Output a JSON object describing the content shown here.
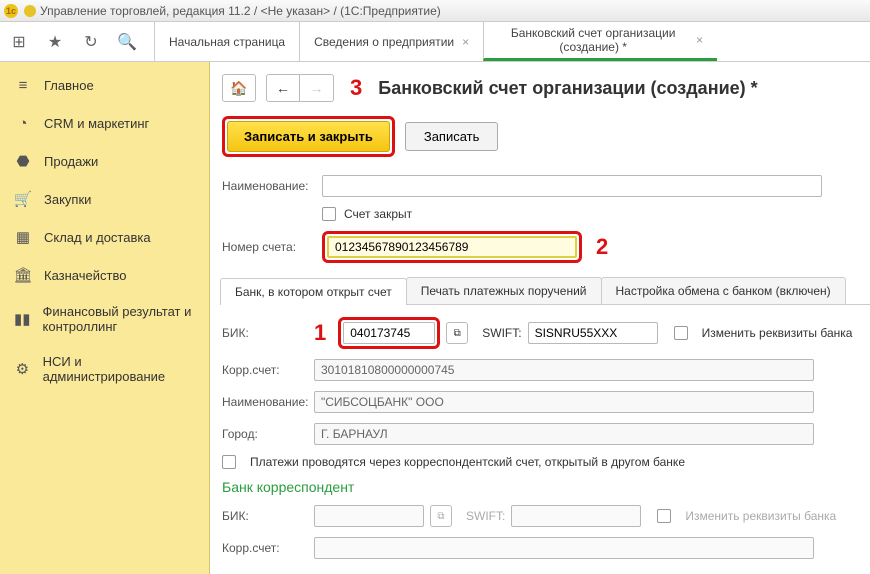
{
  "window": {
    "title": "Управление торговлей, редакция 11.2 / <Не указан> / (1С:Предприятие)"
  },
  "topTabs": [
    {
      "label": "Начальная страница"
    },
    {
      "label": "Сведения о предприятии"
    },
    {
      "label": "Банковский счет организации (создание) *",
      "active": true
    }
  ],
  "sidebar": {
    "items": [
      {
        "icon": "menu",
        "label": "Главное"
      },
      {
        "icon": "pie",
        "label": "CRM и маркетинг"
      },
      {
        "icon": "tag",
        "label": "Продажи"
      },
      {
        "icon": "cart",
        "label": "Закупки"
      },
      {
        "icon": "grid",
        "label": "Склад и доставка"
      },
      {
        "icon": "bank",
        "label": "Казначейство"
      },
      {
        "icon": "bars",
        "label": "Финансовый результат и контроллинг"
      },
      {
        "icon": "gear",
        "label": "НСИ и администрирование"
      }
    ]
  },
  "page": {
    "title": "Банковский счет организации (создание) *",
    "actions": {
      "saveClose": "Записать и закрыть",
      "save": "Записать"
    },
    "annot": {
      "a1": "1",
      "a2": "2",
      "a3": "3"
    },
    "fields": {
      "nameLabel": "Наименование:",
      "closedLabel": "Счет закрыт",
      "accLabel": "Номер счета:",
      "accValue": "01234567890123456789"
    },
    "subTabs": [
      "Банк, в котором открыт счет",
      "Печать платежных поручений",
      "Настройка обмена с банком (включен)"
    ],
    "bank": {
      "bikLabel": "БИК:",
      "bikValue": "040173745",
      "swiftLabel": "SWIFT:",
      "swiftValue": "SISNRU55XXX",
      "editReqLabel": "Изменить реквизиты банка",
      "corrLabel": "Корр.счет:",
      "corrValue": "30101810800000000745",
      "bankNameLabel": "Наименование:",
      "bankNameValue": "\"СИБСОЦБАНК\" ООО",
      "cityLabel": "Город:",
      "cityValue": "Г. БАРНАУЛ",
      "viaCorr": "Платежи проводятся через корреспондентский счет, открытый в другом банке",
      "corrHeader": "Банк корреспондент",
      "bik2Label": "БИК:",
      "swift2Label": "SWIFT:",
      "editReq2Label": "Изменить реквизиты банка",
      "corr2Label": "Корр.счет:"
    }
  }
}
